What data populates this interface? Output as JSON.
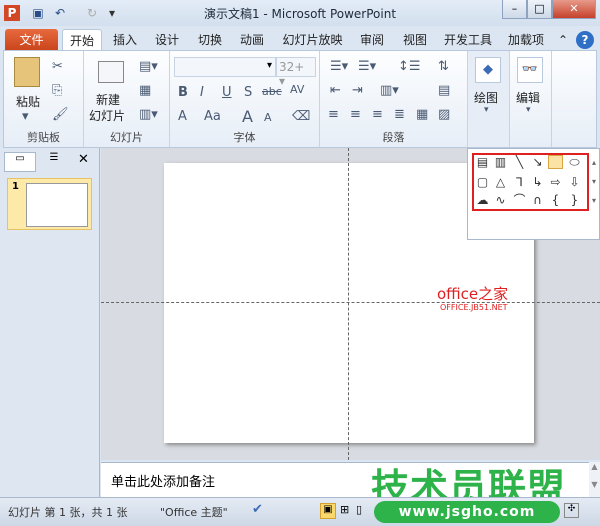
{
  "title": "演示文稿1 - Microsoft PowerPoint",
  "tabs": [
    "文件",
    "开始",
    "插入",
    "设计",
    "切换",
    "动画",
    "幻灯片放映",
    "审阅",
    "视图",
    "开发工具",
    "加载项"
  ],
  "ribbon": {
    "clipboard": {
      "paste": "粘贴",
      "label": "剪贴板"
    },
    "slides": {
      "new_slide_1": "新建",
      "new_slide_2": "幻灯片",
      "label": "幻灯片"
    },
    "font": {
      "font_size": "32+",
      "bold": "B",
      "italic": "I",
      "underline": "U",
      "shadow": "S",
      "strike": "abc",
      "spacing": "AV",
      "color": "A",
      "case": "Aa",
      "grow": "A",
      "shrink": "A",
      "label": "字体"
    },
    "paragraph": {
      "label": "段落"
    },
    "drawing": {
      "label": "绘图"
    },
    "editing": {
      "label": "编辑"
    }
  },
  "thumbnail": {
    "number": "1"
  },
  "notes": {
    "placeholder": "单击此处添加备注"
  },
  "status": {
    "slide_info": "幻灯片 第 1 张，共 1 张",
    "theme": "\"Office 主题\""
  },
  "watermarks": {
    "office": "office之家",
    "office_url": "OFFICE.JB51.NET",
    "brand": "技术员联盟",
    "brand_url": "www.jsgho.com"
  },
  "colors": {
    "file_tab": "#d4532a",
    "accent": "#2b579a",
    "selection": "#e02020",
    "watermark_green": "#2db34a"
  }
}
